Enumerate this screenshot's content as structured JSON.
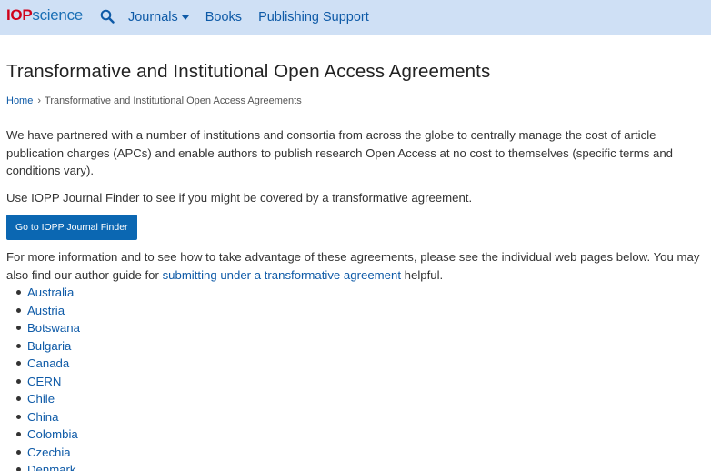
{
  "header": {
    "logo_iop": "IOP",
    "logo_science": "science",
    "nav": {
      "journals": "Journals",
      "books": "Books",
      "publishing_support": "Publishing Support"
    }
  },
  "page": {
    "title": "Transformative and Institutional Open Access Agreements",
    "breadcrumb": {
      "home": "Home",
      "current": "Transformative and Institutional Open Access Agreements"
    },
    "intro": "We have partnered with a number of institutions and consortia from across the globe to centrally manage the cost of article publication charges (APCs) and enable authors to publish research Open Access at no cost to themselves (specific terms and conditions vary).",
    "finder_text": "Use IOPP Journal Finder to see if you might be covered by a transformative agreement.",
    "finder_button": "Go to IOPP Journal Finder",
    "more_info_before": "For more information and to see how to take advantage of these agreements, please see the individual web pages below. You may also find our author guide for ",
    "more_info_link": "submitting under a transformative agreement",
    "more_info_after": " helpful.",
    "countries": [
      "Australia",
      "Austria",
      "Botswana",
      "Bulgaria",
      "Canada",
      "CERN",
      "Chile",
      "China",
      "Colombia",
      "Czechia",
      "Denmark"
    ]
  },
  "colors": {
    "header_bg": "#cfe0f5",
    "link": "#0e5aa7",
    "button_bg": "#0b67b2",
    "logo_red": "#d0021b"
  }
}
